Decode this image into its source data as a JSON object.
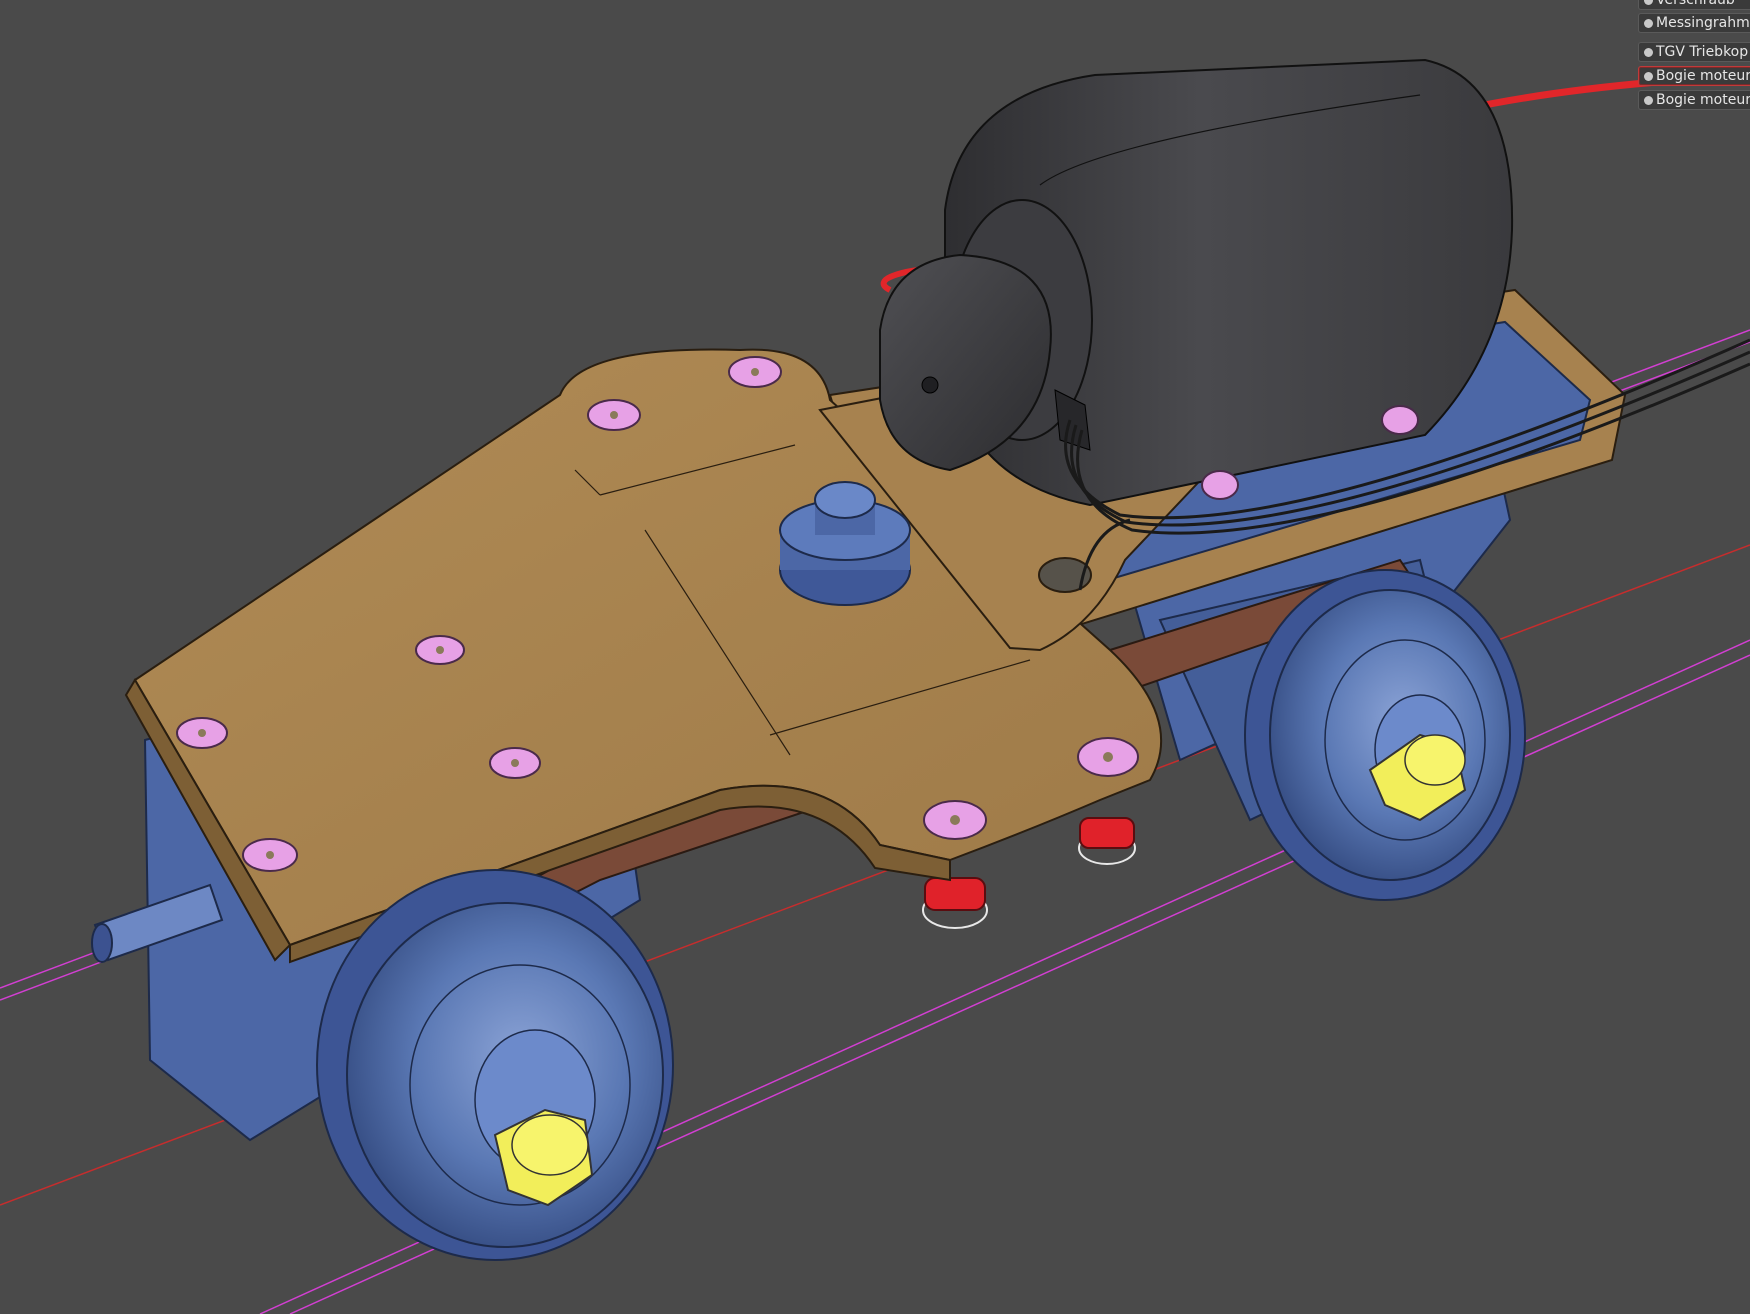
{
  "layer_panel": {
    "items": [
      {
        "label": "Verschraub",
        "active": false
      },
      {
        "label": "Messingrahm",
        "active": false
      },
      {
        "label": "TGV Triebkop",
        "active": false
      },
      {
        "label": "Bogie moteur",
        "active": true
      },
      {
        "label": "Bogie moteur",
        "active": false
      }
    ]
  },
  "colors": {
    "background": "#4a4a4a",
    "frame_brown": "#a7824f",
    "bogie_blue": "#5a78b4",
    "motor_gray": "#3f3f42",
    "screw_pink": "#e7a1e6",
    "axle_yellow": "#f2ee5a",
    "pad_red": "#e0222a",
    "guide_magenta": "#d23fd2",
    "guide_red": "#c62d2d",
    "wire_red": "#e1262a",
    "spring_brown": "#7a4a38"
  },
  "icons": {
    "layer_visibility": "dot-icon"
  }
}
